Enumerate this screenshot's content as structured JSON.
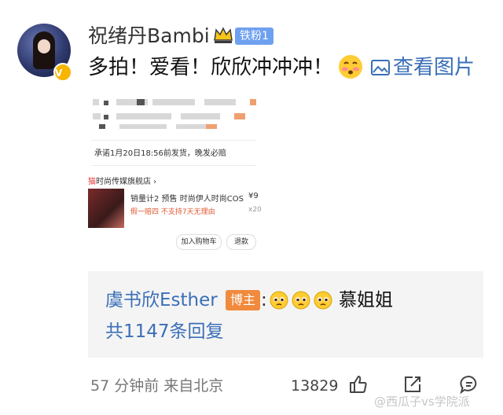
{
  "comment": {
    "username": "祝绪丹Bambi",
    "fan_badge": "铁粉1",
    "text": "多拍！爱看！欣欣冲冲冲！",
    "view_image_label": "查看图片"
  },
  "embedded_image": {
    "promise_text": "承诺1月20日18:56前发货，晚发必赔",
    "store_icon_text": "猫",
    "store_name": "时尚传媒旗舰店 ›",
    "product_title": "销量计2 预售 时尚伊人时尚COS",
    "product_price": "¥9",
    "product_tags": "假一赔四  不支持7天无理由",
    "product_qty": "x20",
    "add_cart_label": "加入购物车",
    "refund_label": "退款"
  },
  "reply": {
    "author": "虞书欣Esther",
    "author_badge": "博主",
    "colon": ":",
    "text": "慕姐姐",
    "total": "共1147条回复"
  },
  "footer": {
    "time": "57 分钟前",
    "source": "来自北京",
    "like_count": "13829",
    "watermark": "@西瓜子vs学院派"
  },
  "colors": {
    "link_blue": "#3a6fb8",
    "fan_badge": "#6ea0f0",
    "blogger_badge": "#f08a3c",
    "reply_bg": "#f4f4f4"
  }
}
